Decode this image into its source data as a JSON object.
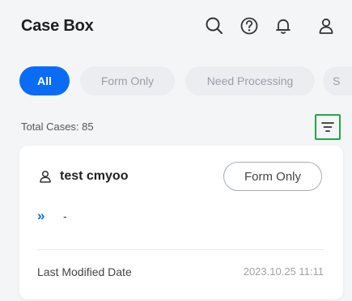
{
  "header": {
    "title": "Case Box",
    "icons": [
      "search-icon",
      "help-icon",
      "bell-icon",
      "user-icon"
    ]
  },
  "tabs": [
    {
      "label": "All",
      "active": true
    },
    {
      "label": "Form Only",
      "active": false
    },
    {
      "label": "Need Processing",
      "active": false
    },
    {
      "label": "S",
      "active": false
    }
  ],
  "summary": {
    "total_label": "Total Cases: 85"
  },
  "case": {
    "name": "test cmyoo",
    "status": "Form Only",
    "step_text": "-",
    "meta_label": "Last Modified Date",
    "meta_value": "2023.10.25 11:11"
  },
  "colors": {
    "accent": "#0a6cf5",
    "filter_highlight": "#27a34a"
  }
}
